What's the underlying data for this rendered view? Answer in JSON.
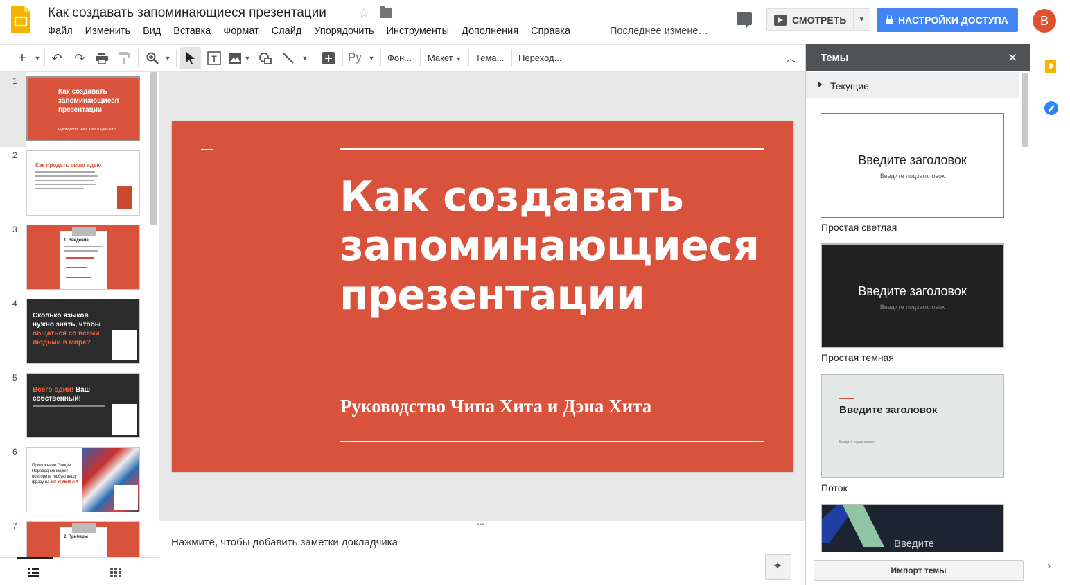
{
  "header": {
    "doc_title": "Как создавать запоминающиеся презентации",
    "menu": [
      "Файл",
      "Изменить",
      "Вид",
      "Вставка",
      "Формат",
      "Слайд",
      "Упорядочить",
      "Инструменты",
      "Дополнения",
      "Справка"
    ],
    "last_edit": "Последнее измене…",
    "present_label": "СМОТРЕТЬ",
    "share_label": "НАСТРОЙКИ ДОСТУПА",
    "avatar_letter": "В"
  },
  "toolbar": {
    "input_tools": "Ру",
    "background": "Фон...",
    "layout": "Макет",
    "theme": "Тема...",
    "transition": "Переход..."
  },
  "filmstrip": {
    "slides": [
      {
        "num": "1",
        "title": "Как создавать запоминающиеся презентации",
        "subtitle": "Руководство Чипа Хита и Дэна Хита"
      },
      {
        "num": "2",
        "title": "Как продать свою идею"
      },
      {
        "num": "3",
        "title": "1. Введение"
      },
      {
        "num": "4",
        "title": "Сколько языков нужно знать, чтобы",
        "accent": "общаться со всеми людьми в мире?"
      },
      {
        "num": "5",
        "accent": "Всего один!",
        "title": "Ваш собственный!"
      },
      {
        "num": "6",
        "title": "Приложение Google Переводчик может повторить любую вашу фразу на",
        "accent": "90 ЯЗЫКАХ"
      },
      {
        "num": "7",
        "title": "2. Примеры"
      }
    ]
  },
  "slide": {
    "title": "Как создавать запоминающиеся презентации",
    "subtitle": "Руководство Чипа Хита и Дэна Хита"
  },
  "notes": {
    "placeholder": "Нажмите, чтобы добавить заметки докладчика"
  },
  "themes": {
    "panel_title": "Темы",
    "current_label": "Текущие",
    "items": [
      {
        "name": "Простая светлая",
        "title": "Введите заголовок",
        "subtitle": "Введите подзаголовок"
      },
      {
        "name": "Простая темная",
        "title": "Введите заголовок",
        "subtitle": "Введите подзаголовок"
      },
      {
        "name": "Поток",
        "title": "Введите заголовок",
        "subtitle": "Введите подзаголовок"
      },
      {
        "name": "",
        "title": "Введите"
      }
    ],
    "import_label": "Импорт темы"
  },
  "colors": {
    "accent": "#d9533c",
    "share_blue": "#4285f4",
    "dark": "#222222"
  }
}
